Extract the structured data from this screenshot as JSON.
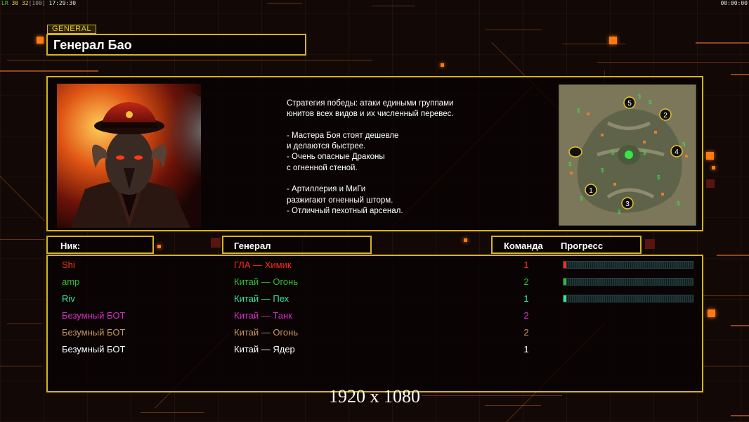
{
  "hud": {
    "left_prefix": "LR",
    "left_fps": "30",
    "left_fps2": "32",
    "left_bracket": "[100]",
    "left_time": "17:29:30",
    "right_time": "00:00:00"
  },
  "general_tag": "GENERAL",
  "general_name": "Генерал Бао",
  "description": "Стратегия победы: атаки едиными группами\nюнитов всех видов и их численный перевес.\n\n- Мастера Боя стоят дешевле\nи делаются быстрее.\n- Очень опасные Драконы\nс огненной стеной.\n\n- Артиллерия и МиГи\nразжигают огненный шторм.\n- Отличный пехотный арсенал.",
  "map": {
    "start_positions": [
      "1",
      "2",
      "3",
      "4",
      "5"
    ]
  },
  "columns": {
    "nick": "Ник:",
    "general": "Генерал",
    "team": "Команда",
    "progress": "Прогресс"
  },
  "players": [
    {
      "nick": "Shi",
      "general": "ГЛА — Химик",
      "team": "1",
      "color": "#ff2a1a",
      "progress": 0.01,
      "show_progress": true
    },
    {
      "nick": "amp",
      "general": "Китай — Огонь",
      "team": "2",
      "color": "#2fbf2f",
      "progress": 0.015,
      "show_progress": true
    },
    {
      "nick": "Riv",
      "general": "Китай — Пех",
      "team": "1",
      "color": "#34e6a0",
      "progress": 0.01,
      "show_progress": true
    },
    {
      "nick": "Безумный БОТ",
      "general": "Китай — Танк",
      "team": "2",
      "color": "#d62fc8",
      "progress": 0,
      "show_progress": false
    },
    {
      "nick": "Безумный БОТ",
      "general": "Китай — Огонь",
      "team": "2",
      "color": "#c9965c",
      "progress": 0,
      "show_progress": false
    },
    {
      "nick": "Безумный БОТ",
      "general": "Китай — Ядер",
      "team": "1",
      "color": "#ffffff",
      "progress": 0,
      "show_progress": false
    }
  ],
  "resolution": "1920 x 1080",
  "colors": {
    "border": "#d6b41c",
    "accent": "#ff7a10",
    "background": "#120907"
  }
}
